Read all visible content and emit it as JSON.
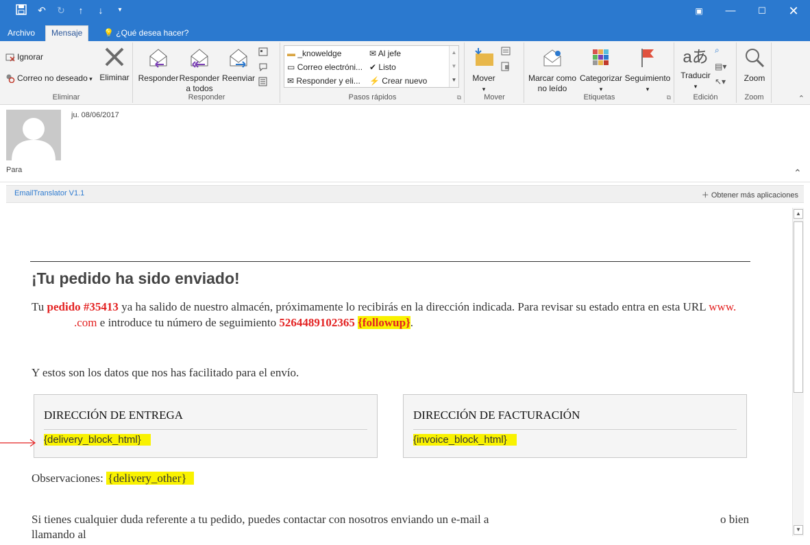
{
  "tabs": {
    "archivo": "Archivo",
    "mensaje": "Mensaje",
    "tell_me": "¿Qué desea hacer?"
  },
  "ribbon": {
    "eliminar_group": {
      "ignorar": "Ignorar",
      "correo_no_deseado": "Correo no deseado",
      "eliminar": "Eliminar",
      "label": "Eliminar"
    },
    "responder_group": {
      "responder": "Responder",
      "responder_todos_1": "Responder",
      "responder_todos_2": "a todos",
      "reenviar": "Reenviar",
      "label": "Responder"
    },
    "pasos_rapidos": {
      "items": [
        "_knoweldge",
        "Al jefe",
        "Correo electróni...",
        "Listo",
        "Responder y eli...",
        "Crear nuevo"
      ],
      "label": "Pasos rápidos"
    },
    "mover_group": {
      "mover": "Mover",
      "label": "Mover"
    },
    "etiquetas_group": {
      "marcar_1": "Marcar como",
      "marcar_2": "no leído",
      "categorizar": "Categorizar",
      "seguimiento": "Seguimiento",
      "label": "Etiquetas"
    },
    "edicion_group": {
      "traducir": "Traducir",
      "label": "Edición"
    },
    "zoom_group": {
      "zoom": "Zoom",
      "label": "Zoom"
    }
  },
  "header": {
    "date": "ju. 08/06/2017",
    "para": "Para"
  },
  "apps": {
    "addin": "EmailTranslator V1.1",
    "more": "Obtener más aplicaciones"
  },
  "email": {
    "heading": "¡Tu pedido ha sido enviado!",
    "p1_a": "Tu ",
    "p1_order": "pedido #35413",
    "p1_b": " ya ha salido de nuestro almacén, próximamente lo recibirás en la dirección indicada. Para revisar su estado entra en esta URL ",
    "p1_url_a": "www.",
    "p1_url_b": ".com",
    "p1_c": " e introduce tu número de seguimiento ",
    "p1_tracking": "5264489102365",
    "p1_followup": "{followup}",
    "p1_end": ".",
    "p2": "Y estos son los datos que nos has facilitado para el envío.",
    "delivery_title": "DIRECCIÓN DE ENTREGA",
    "delivery_value": "{delivery_block_html}",
    "invoice_title": "DIRECCIÓN DE FACTURACIÓN",
    "invoice_value": "{invoice_block_html}",
    "obs_label": "Observaciones: ",
    "obs_value": "{delivery_other}",
    "p3_a": "Si tienes cualquier duda referente a tu pedido, puedes contactar con nosotros enviando un e-mail a",
    "p3_b": "o bien",
    "p3_c": "llamando al"
  },
  "colors": {
    "titlebar": "#2b79cf",
    "highlight": "#f9f200",
    "order_red": "#e32222"
  }
}
